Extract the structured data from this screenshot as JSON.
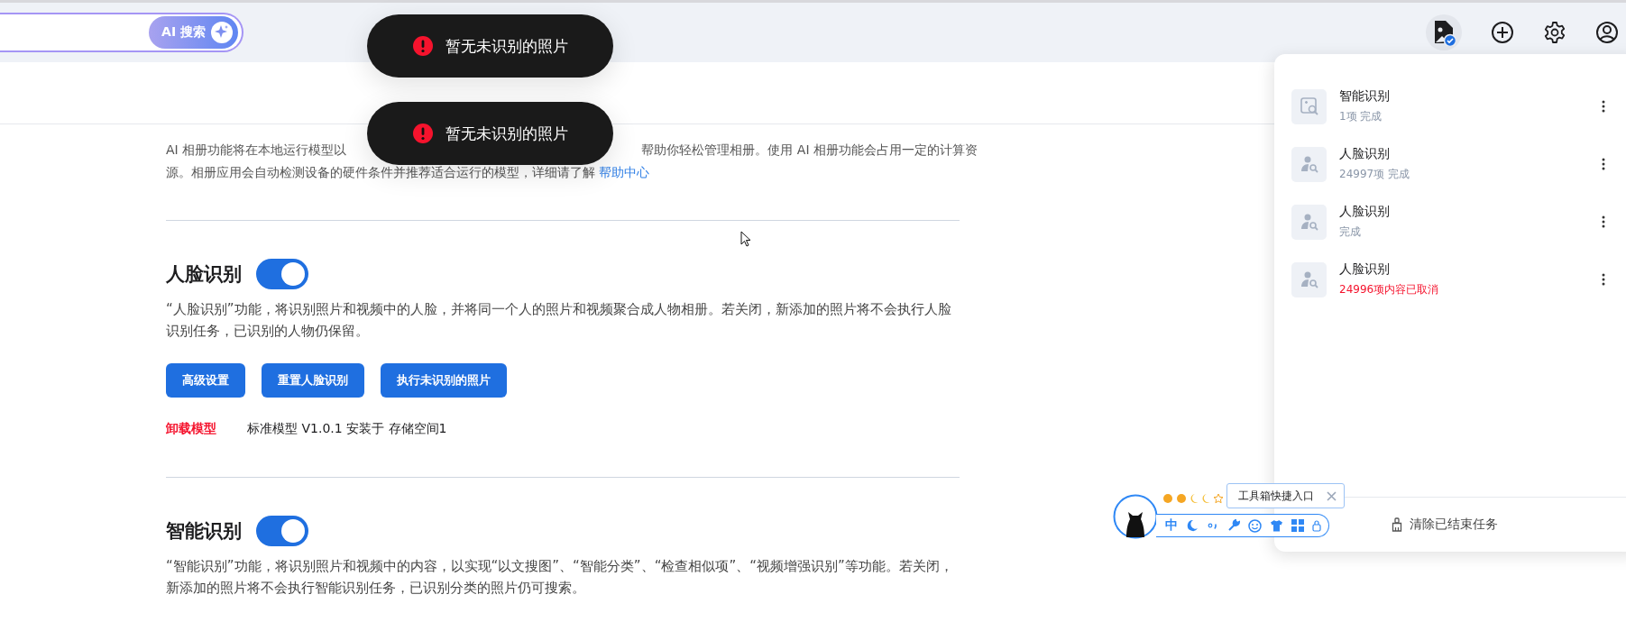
{
  "search": {
    "ai_button": "AI 搜索"
  },
  "toasts": [
    {
      "text": "暂无未识别的照片"
    },
    {
      "text": "暂无未识别的照片"
    }
  ],
  "intro": {
    "line_1_left": "AI 相册功能将在本地运行模型以",
    "line_1_right": "帮助你轻松管理相册。使用 AI 相册功能会占用一定的计算资",
    "line_2": "源。相册应用会自动检测设备的硬件条件并推荐适合运行的模型，详细请了解 ",
    "link": "帮助中心"
  },
  "sections": [
    {
      "title": "人脸识别",
      "enabled": true,
      "description": "“人脸识别”功能，将识别照片和视频中的人脸，并将同一个人的照片和视频聚合成人物相册。若关闭，新添加的照片将不会执行人脸识别任务，已识别的人物仍保留。",
      "buttons": [
        "高级设置",
        "重置人脸识别",
        "执行未识别的照片"
      ],
      "model": {
        "action": "卸载模型",
        "info": "标准模型 V1.0.1 安装于 存储空间1"
      }
    },
    {
      "title": "智能识别",
      "enabled": true,
      "description": "“智能识别”功能，将识别照片和视频中的内容，以实现“以文搜图”、“智能分类”、“检查相似项”、“视频增强识别”等功能。若关闭，新添加的照片将不会执行智能识别任务，已识别分类的照片仍可搜索。"
    }
  ],
  "task_panel": {
    "tasks": [
      {
        "kind": "smart",
        "title": "智能识别",
        "status": "1项 完成",
        "cancelled": false
      },
      {
        "kind": "face",
        "title": "人脸识别",
        "status": "24997项 完成",
        "cancelled": false
      },
      {
        "kind": "face",
        "title": "人脸识别",
        "status": "完成",
        "cancelled": false
      },
      {
        "kind": "face",
        "title": "人脸识别",
        "status": "24996项内容已取消",
        "cancelled": true
      }
    ],
    "clear_button": "清除已结束任务"
  },
  "widget": {
    "tooltip": "工具箱快捷入口",
    "input_mode": "中"
  }
}
